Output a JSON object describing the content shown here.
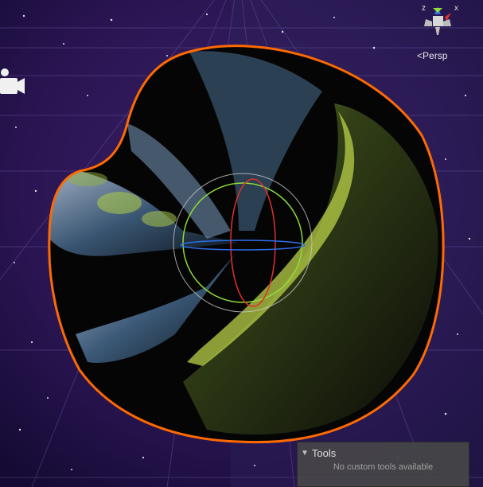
{
  "scene": {
    "projection_label": "Persp",
    "axis_labels": {
      "x": "x",
      "z": "z"
    },
    "selection_outline_color": "#ff6a00",
    "sky_colors": [
      "#2a1a55",
      "#3a1f5e",
      "#120a30"
    ]
  },
  "icons": {
    "camera": "scene-camera-icon",
    "gizmo": "orientation-gizmo-icon",
    "foldout": "foldout-arrow-icon"
  },
  "tools_panel": {
    "title": "Tools",
    "message": "No custom tools available",
    "arrow": "▼"
  }
}
